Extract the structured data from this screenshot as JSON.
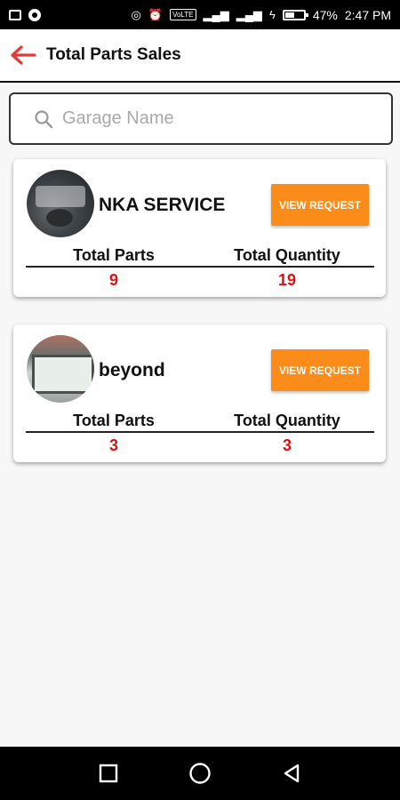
{
  "status_bar": {
    "battery": "47%",
    "time": "2:47 PM",
    "network": "VoLTE"
  },
  "header": {
    "title": "Total Parts Sales"
  },
  "search": {
    "placeholder": "Garage Name"
  },
  "garages": [
    {
      "name": "NKA SERVICE",
      "button_label": "VIEW REQUEST",
      "total_parts_label": "Total Parts",
      "total_quantity_label": "Total Quantity",
      "total_parts": "9",
      "total_quantity": "19"
    },
    {
      "name": "beyond",
      "button_label": "VIEW REQUEST",
      "total_parts_label": "Total Parts",
      "total_quantity_label": "Total Quantity",
      "total_parts": "3",
      "total_quantity": "3"
    }
  ],
  "colors": {
    "accent": "#fb8c1a",
    "back_arrow": "#e53935",
    "value": "#dd1111"
  },
  "icons": [
    "back-arrow-icon",
    "search-icon",
    "square-nav-icon",
    "circle-nav-icon",
    "triangle-back-nav-icon"
  ]
}
